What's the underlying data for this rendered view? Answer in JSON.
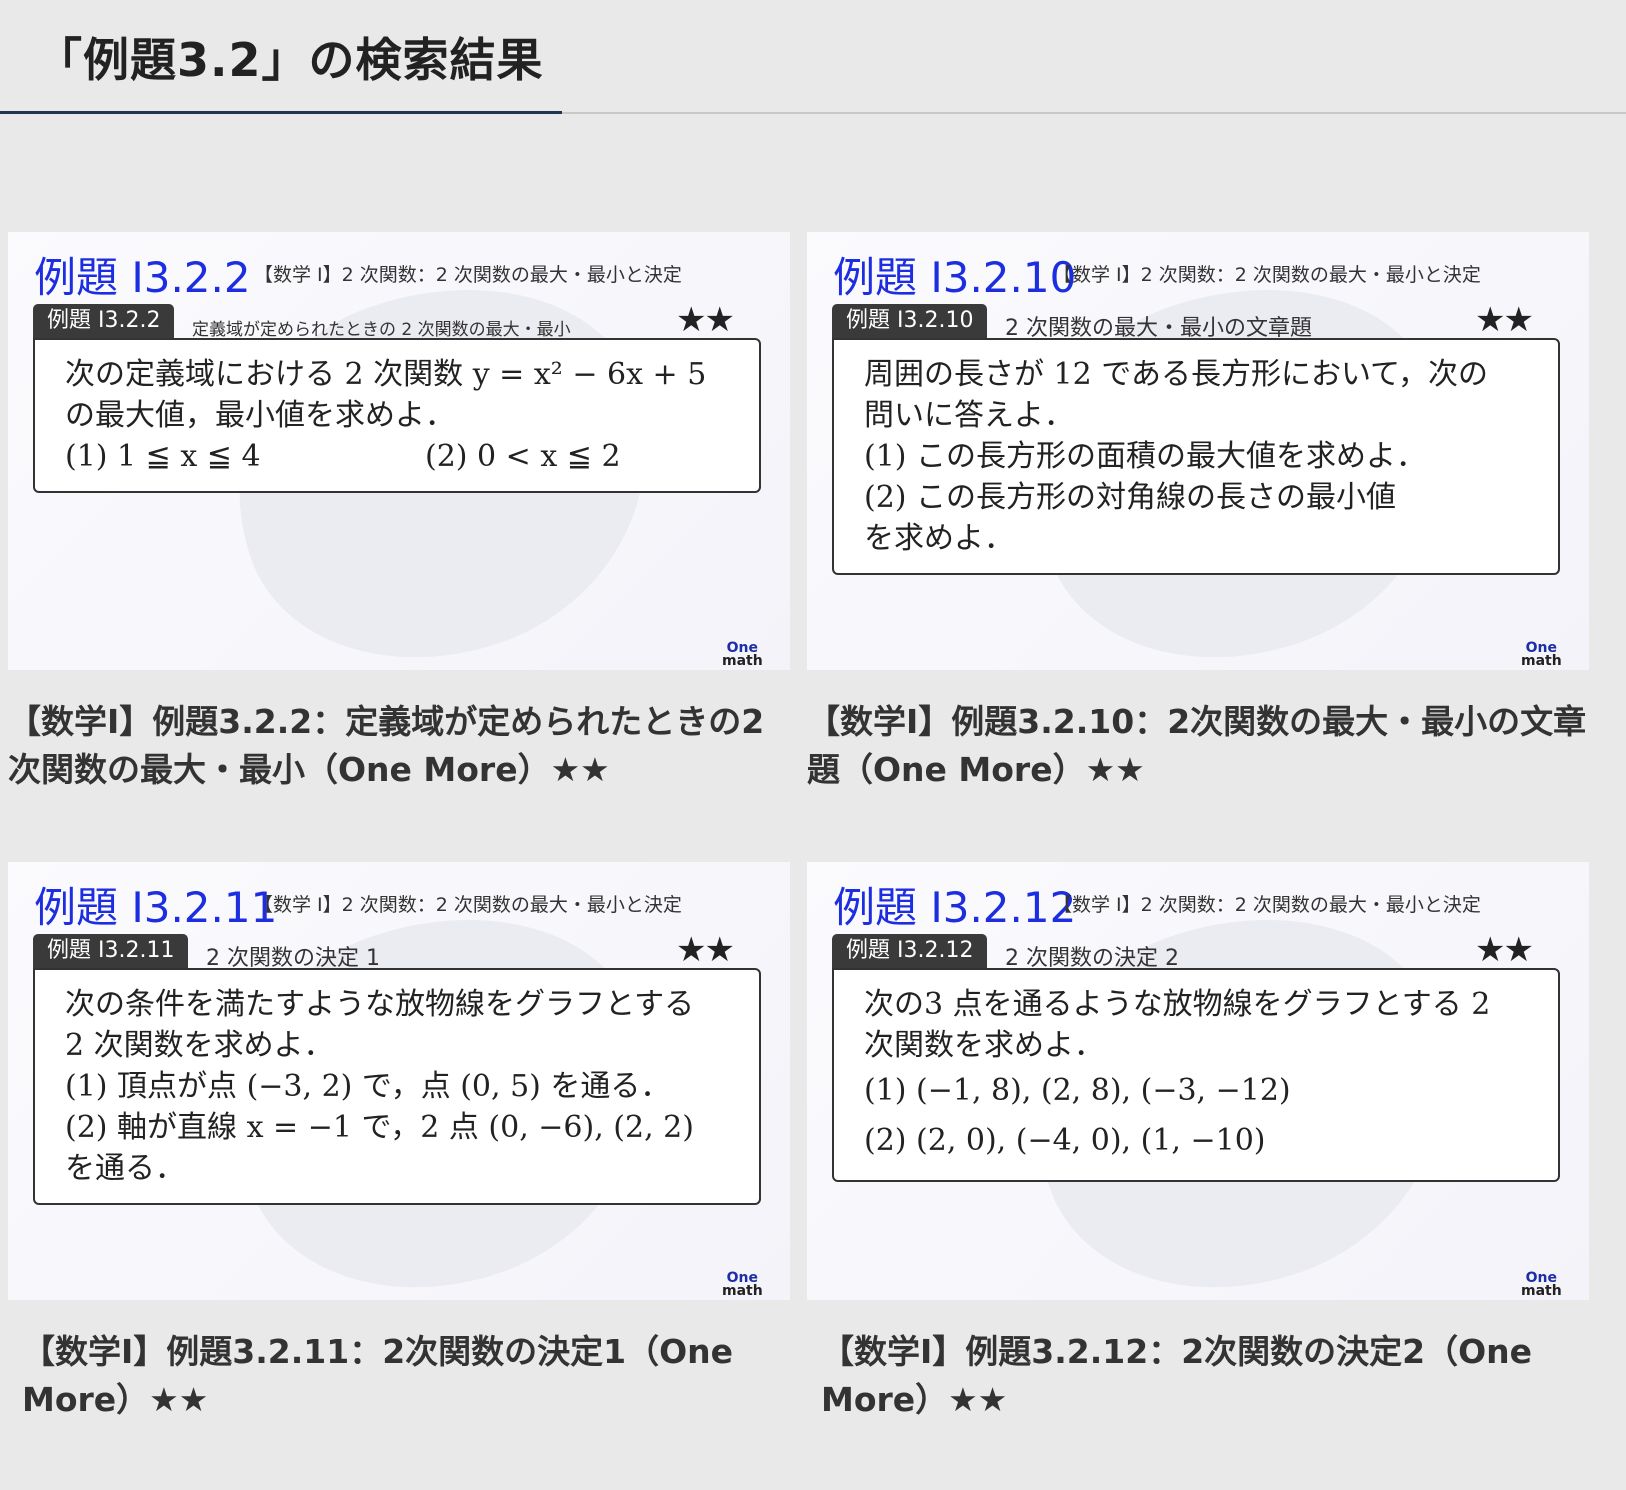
{
  "header": {
    "title": "「例題3.2」の検索結果"
  },
  "cards": [
    {
      "ex_title": "例題 I3.2.2",
      "subject": "【数学 I】2 次関数：2 次関数の最大・最小と決定",
      "tag": "例題 I3.2.2",
      "tag_desc": "定義域が定められたときの 2 次関数の最大・最小",
      "stars": "★★",
      "problem": [
        "次の定義域における 2 次関数 y = x² − 6x + 5",
        "の最大値，最小値を求めよ．",
        "(1)  1 ≦ x ≦ 4",
        "(2)  0 < x ≦ 2"
      ],
      "logo_top": "One",
      "logo_bottom": "math",
      "title": "【数学Ⅰ】例題3.2.2：定義域が定められたときの2次関数の最大・最小（One More）★★"
    },
    {
      "ex_title": "例題 I3.2.10",
      "subject": "【数学 I】2 次関数：2 次関数の最大・最小と決定",
      "tag": "例題 I3.2.10",
      "tag_desc": "2 次関数の最大・最小の文章題",
      "stars": "★★",
      "problem": [
        "周囲の長さが 12 である長方形において，次の",
        "問いに答えよ．",
        "(1)  この長方形の面積の最大値を求めよ．",
        "(2)  この長方形の対角線の長さの最小値",
        "を求めよ．"
      ],
      "logo_top": "One",
      "logo_bottom": "math",
      "title": "【数学Ⅰ】例題3.2.10：2次関数の最大・最小の文章題（One More）★★"
    },
    {
      "ex_title": "例題 I3.2.11",
      "subject": "【数学 I】2 次関数：2 次関数の最大・最小と決定",
      "tag": "例題 I3.2.11",
      "tag_desc": "2 次関数の決定 1",
      "stars": "★★",
      "problem": [
        "次の条件を満たすような放物線をグラフとする",
        "2 次関数を求めよ．",
        "(1)  頂点が点 (−3, 2) で，点 (0, 5) を通る．",
        "(2)  軸が直線 x = −1 で，2 点 (0, −6), (2, 2)",
        "を通る．"
      ],
      "logo_top": "One",
      "logo_bottom": "math",
      "title": "【数学Ⅰ】例題3.2.11：2次関数の決定1（One More）★★"
    },
    {
      "ex_title": "例題 I3.2.12",
      "subject": "【数学 I】2 次関数：2 次関数の最大・最小と決定",
      "tag": "例題 I3.2.12",
      "tag_desc": "2 次関数の決定 2",
      "stars": "★★",
      "problem": [
        "次の3 点を通るような放物線をグラフとする 2",
        "次関数を求めよ．",
        "(1)  (−1, 8), (2, 8), (−3, −12)",
        "(2)  (2, 0), (−4, 0), (1, −10)"
      ],
      "logo_top": "One",
      "logo_bottom": "math",
      "title": "【数学Ⅰ】例題3.2.12：2次関数の決定2（One More）★★"
    }
  ]
}
